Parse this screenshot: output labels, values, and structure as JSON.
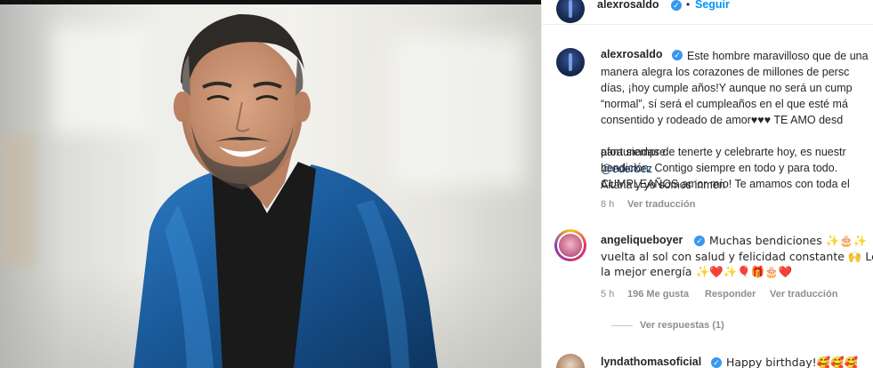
{
  "post": {
    "author": "alexrosaldo",
    "follow_label": "Seguir",
    "separator": "•",
    "caption_lines": [
      "Este hombre maravilloso que de una",
      "manera alegra los corazones de millones de persc",
      "días, ¡hoy cumple años!Y aunque no será un cump",
      "“normal”, sí será el cumpleaños en el que esté má",
      "consentido y rodeado de amor♥♥♥ TE AMO desd",
      "para siempre",
      "Aitana y yo somos inmen",
      "afortunadas de tenerte y celebrarte hoy, es nuestr",
      "bendición. Contigo siempre en todo y para todo.",
      "CUMPLEAÑOS amor mío! Te amamos con toda el"
    ],
    "mention": "@ederbez",
    "time": "8 h",
    "translate_label": "Ver traducción"
  },
  "comments": [
    {
      "username": "angeliqueboyer",
      "lines": [
        "Muchas bendiciones ✨🎂✨",
        "vuelta al sol con salud y felicidad constante 🙌 Le",
        "la mejor energía ✨❤️✨🎈🎁🎂❤️"
      ],
      "time": "5 h",
      "likes": "196 Me gusta",
      "reply_label": "Responder",
      "translate_label": "Ver traducción",
      "view_replies": "Ver respuestas (1)"
    },
    {
      "username": "lyndathomasoficial",
      "lines": [
        "Happy birthday!🥰🥰🥰"
      ]
    }
  ],
  "colors": {
    "accent": "#0095f6",
    "verified": "#3897f0",
    "text": "#262626",
    "muted": "#8e8e8e",
    "jacket": "#1f5f9e"
  }
}
